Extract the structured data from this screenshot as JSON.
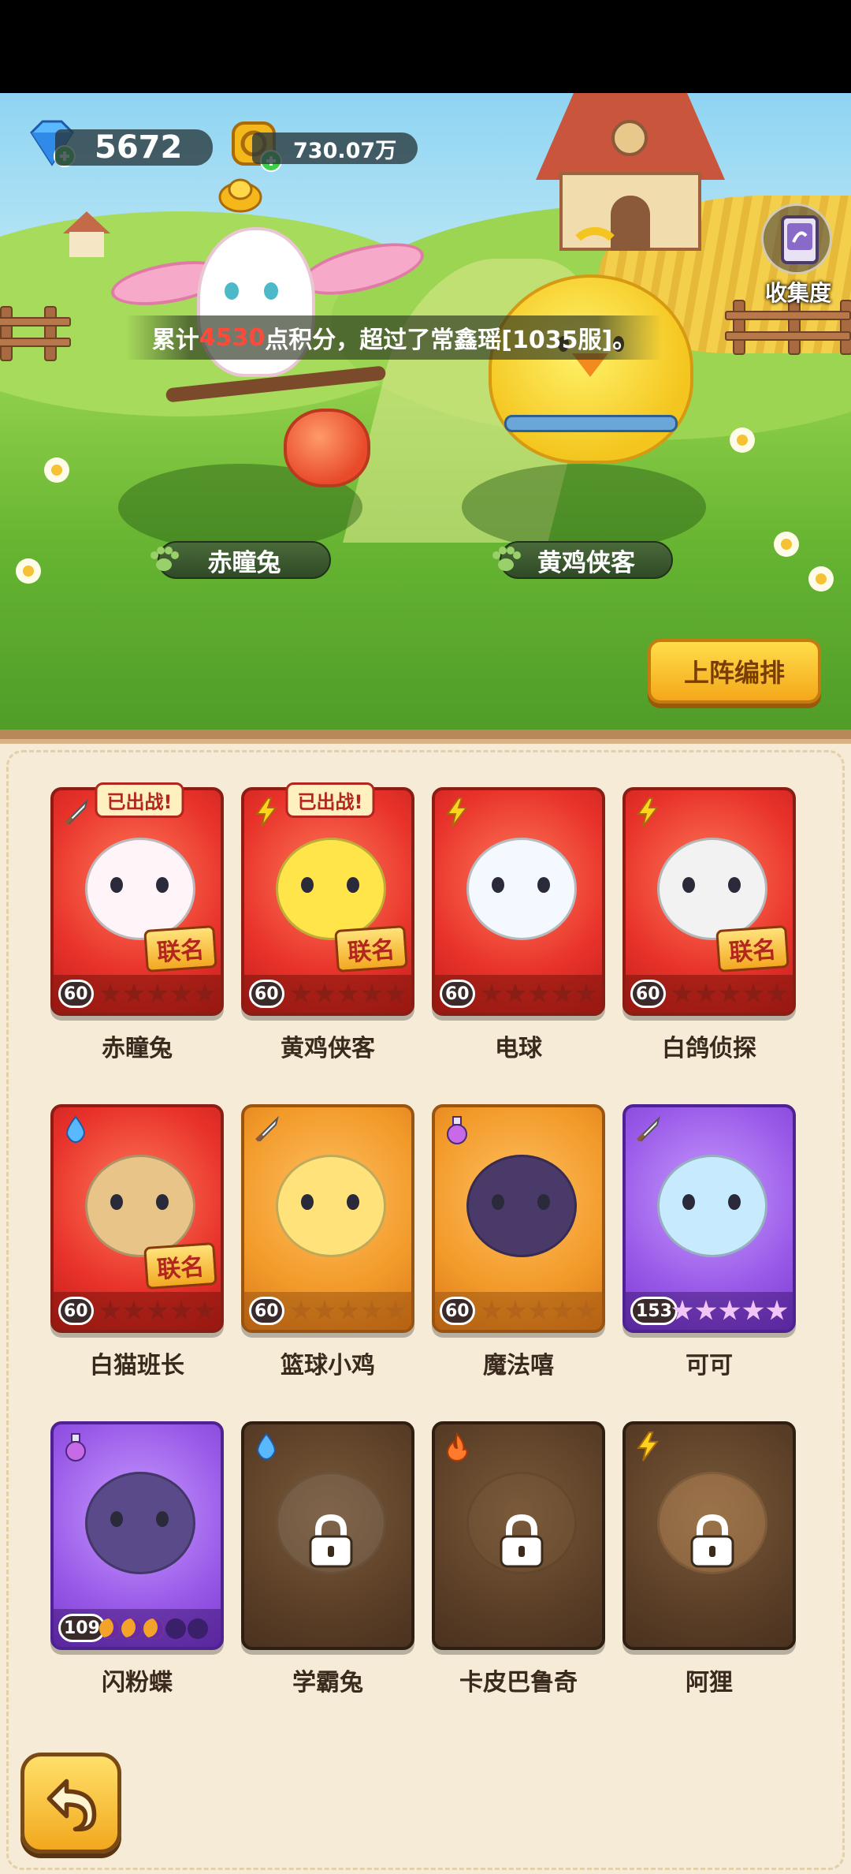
{
  "currency": {
    "gems": "5672",
    "coins": "730.07万"
  },
  "collection_label": "收集度",
  "banner": {
    "prefix": "累计",
    "points": "4530",
    "suffix": "点积分，超过了常鑫瑶[1035服]。"
  },
  "lineup": [
    {
      "name": "赤瞳兔"
    },
    {
      "name": "黄鸡侠客"
    }
  ],
  "formation_button": "上阵编排",
  "deployed_label": "已出战!",
  "collab_label": "联名",
  "cards": [
    {
      "name": "赤瞳兔",
      "level": "60",
      "rarity": "red",
      "element": "sword-icon",
      "deployed": true,
      "collab": true,
      "stars_filled": 0,
      "stars_total": 5,
      "locked": false
    },
    {
      "name": "黄鸡侠客",
      "level": "60",
      "rarity": "red",
      "element": "lightning-icon",
      "deployed": true,
      "collab": true,
      "stars_filled": 0,
      "stars_total": 5,
      "locked": false
    },
    {
      "name": "电球",
      "level": "60",
      "rarity": "red",
      "element": "lightning-icon",
      "deployed": false,
      "collab": false,
      "stars_filled": 0,
      "stars_total": 5,
      "locked": false
    },
    {
      "name": "白鸽侦探",
      "level": "60",
      "rarity": "red",
      "element": "lightning-icon",
      "deployed": false,
      "collab": true,
      "stars_filled": 0,
      "stars_total": 5,
      "locked": false
    },
    {
      "name": "白猫班长",
      "level": "60",
      "rarity": "red",
      "element": "water-drop-icon",
      "deployed": false,
      "collab": true,
      "stars_filled": 0,
      "stars_total": 5,
      "locked": false
    },
    {
      "name": "篮球小鸡",
      "level": "60",
      "rarity": "orange",
      "element": "sword-icon",
      "deployed": false,
      "collab": false,
      "stars_filled": 0,
      "stars_total": 5,
      "locked": false
    },
    {
      "name": "魔法嘻",
      "level": "60",
      "rarity": "orange",
      "element": "potion-icon",
      "deployed": false,
      "collab": false,
      "stars_filled": 0,
      "stars_total": 5,
      "locked": false
    },
    {
      "name": "可可",
      "level": "153",
      "rarity": "purple",
      "element": "sword-icon",
      "deployed": false,
      "collab": false,
      "stars_filled": 5,
      "stars_total": 5,
      "locked": false
    },
    {
      "name": "闪粉蝶",
      "level": "109",
      "rarity": "purple",
      "element": "potion-icon",
      "deployed": false,
      "collab": false,
      "moons_filled": 3,
      "moons_total": 5,
      "locked": false
    },
    {
      "name": "学霸兔",
      "level": "",
      "rarity": "locked",
      "element": "water-drop-icon",
      "deployed": false,
      "collab": false,
      "locked": true
    },
    {
      "name": "卡皮巴鲁奇",
      "level": "",
      "rarity": "locked",
      "element": "fire-icon",
      "deployed": false,
      "collab": false,
      "locked": true
    },
    {
      "name": "阿狸",
      "level": "",
      "rarity": "locked",
      "element": "lightning-icon",
      "deployed": false,
      "collab": false,
      "locked": true
    }
  ],
  "colors": {
    "accent_yellow": "#f4a81a",
    "highlight_red": "#ff4a3a",
    "panel_bg": "#f5ebd6"
  }
}
